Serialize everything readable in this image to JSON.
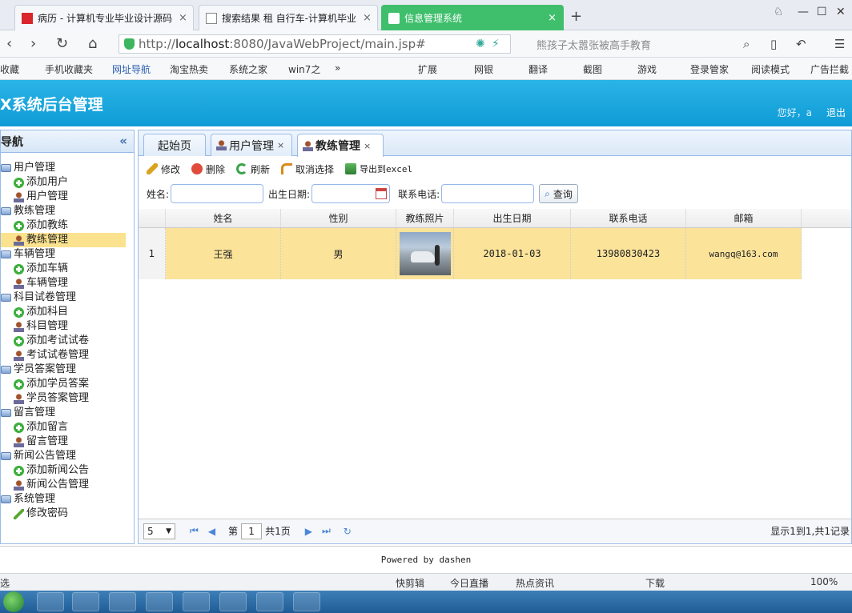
{
  "browser": {
    "tabs": [
      {
        "label": "病历 - 计算机专业毕业设计源码",
        "active": false
      },
      {
        "label": "搜索结果 租 自行车-计算机毕业",
        "active": false
      },
      {
        "label": "信息管理系统",
        "active": true
      }
    ],
    "new_tab": "+",
    "url_host": "localhost",
    "url_prefix": "http://",
    "url_suffix": ":8080/JavaWebProject/main.jsp#",
    "search_placeholder": "熊孩子太嚣张被高手教育",
    "bookmarks": [
      "收藏",
      "手机收藏夹",
      "网址导航",
      "淘宝热卖",
      "系统之家",
      "win7之",
      "»",
      "扩展",
      "网银",
      "翻译",
      "截图",
      "游戏",
      "登录管家",
      "阅读模式",
      "广告拦截"
    ]
  },
  "app": {
    "title": "X系统后台管理",
    "greeting": "您好，a",
    "logout": "退出"
  },
  "sidebar": {
    "title": "导航",
    "collapse": "«",
    "tree": [
      {
        "label": "用户管理",
        "level": 0,
        "icon": "folder-icon"
      },
      {
        "label": "添加用户",
        "level": 1,
        "icon": "add-icon"
      },
      {
        "label": "用户管理",
        "level": 1,
        "icon": "user-icon"
      },
      {
        "label": "教练管理",
        "level": 0,
        "icon": "folder-icon"
      },
      {
        "label": "添加教练",
        "level": 1,
        "icon": "add-icon"
      },
      {
        "label": "教练管理",
        "level": 1,
        "icon": "user-icon",
        "selected": true
      },
      {
        "label": "车辆管理",
        "level": 0,
        "icon": "folder-icon"
      },
      {
        "label": "添加车辆",
        "level": 1,
        "icon": "add-icon"
      },
      {
        "label": "车辆管理",
        "level": 1,
        "icon": "user-icon"
      },
      {
        "label": "科目试卷管理",
        "level": 0,
        "icon": "folder-icon"
      },
      {
        "label": "添加科目",
        "level": 1,
        "icon": "add-icon"
      },
      {
        "label": "科目管理",
        "level": 1,
        "icon": "user-icon"
      },
      {
        "label": "添加考试试卷",
        "level": 1,
        "icon": "add-icon"
      },
      {
        "label": "考试试卷管理",
        "level": 1,
        "icon": "user-icon"
      },
      {
        "label": "学员答案管理",
        "level": 0,
        "icon": "folder-icon"
      },
      {
        "label": "添加学员答案",
        "level": 1,
        "icon": "add-icon"
      },
      {
        "label": "学员答案管理",
        "level": 1,
        "icon": "user-icon"
      },
      {
        "label": "留言管理",
        "level": 0,
        "icon": "folder-icon"
      },
      {
        "label": "添加留言",
        "level": 1,
        "icon": "add-icon"
      },
      {
        "label": "留言管理",
        "level": 1,
        "icon": "user-icon"
      },
      {
        "label": "新闻公告管理",
        "level": 0,
        "icon": "folder-icon"
      },
      {
        "label": "添加新闻公告",
        "level": 1,
        "icon": "add-icon"
      },
      {
        "label": "新闻公告管理",
        "level": 1,
        "icon": "user-icon"
      },
      {
        "label": "系统管理",
        "level": 0,
        "icon": "folder-icon"
      },
      {
        "label": "修改密码",
        "level": 1,
        "icon": "pen-icon"
      }
    ]
  },
  "main": {
    "tabs": [
      {
        "label": "起始页",
        "closable": false,
        "active": false
      },
      {
        "label": "用户管理",
        "closable": true,
        "active": false
      },
      {
        "label": "教练管理",
        "closable": true,
        "active": true
      }
    ],
    "toolbar": {
      "edit": "修改",
      "delete": "删除",
      "refresh": "刷新",
      "deselect": "取消选择",
      "export": "导出到excel"
    },
    "filters": {
      "name_label": "姓名:",
      "birth_label": "出生日期:",
      "phone_label": "联系电话:",
      "query": "查询"
    },
    "columns": [
      "姓名",
      "性别",
      "教练照片",
      "出生日期",
      "联系电话",
      "邮箱"
    ],
    "rows": [
      {
        "index": "1",
        "name": "王强",
        "gender": "男",
        "birth": "2018-01-03",
        "phone": "13980830423",
        "email": "wangq@163.com"
      }
    ],
    "pager": {
      "page_size": "5",
      "page_prefix": "第",
      "page_value": "1",
      "page_total": "共1页",
      "info": "显示1到1,共1记录"
    }
  },
  "footer": "Powered by dashen",
  "statusbar": [
    "选",
    "快剪辑",
    "今日直播",
    "热点资讯",
    "下载",
    "100%"
  ]
}
